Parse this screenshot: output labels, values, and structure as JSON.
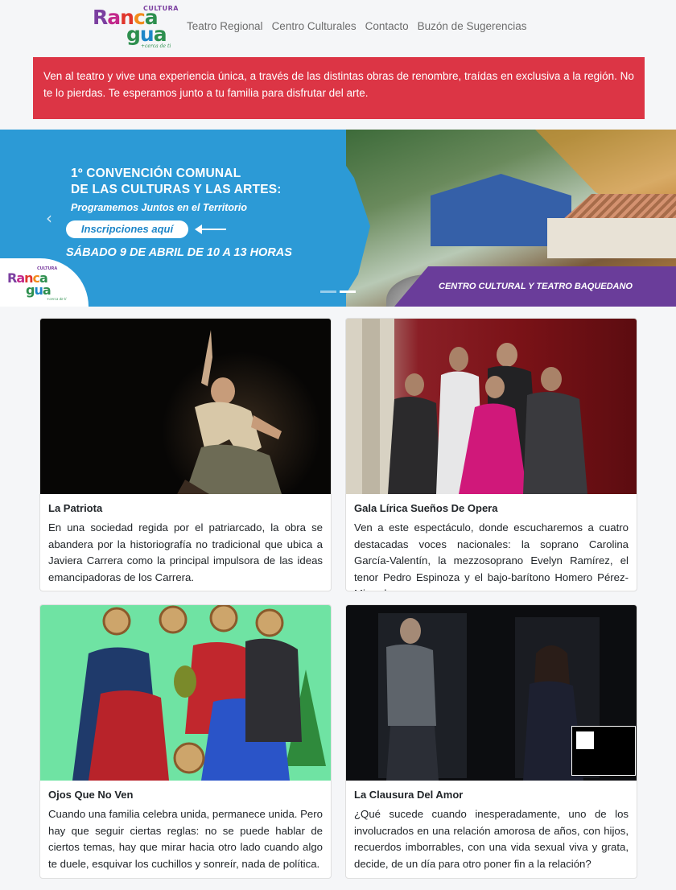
{
  "logo": {
    "top": "CULTURA",
    "word1": "Ranca",
    "word2": "gua",
    "tagline": "+cerca de ti"
  },
  "nav": {
    "links": [
      "Teatro Regional",
      "Centro Culturales",
      "Contacto",
      "Buzón de Sugerencias"
    ]
  },
  "alert": {
    "text": "Ven al teatro y vive una experiencia única, a través de las distintas obras de renombre, traídas en exclusiva a la región. No te lo pierdas. Te esperamos junto a tu familia para disfrutar del arte."
  },
  "carousel": {
    "title_line1": "1º CONVENCIÓN COMUNAL",
    "title_line2": "DE LAS CULTURAS Y LAS ARTES:",
    "subtitle": "Programemos Juntos en el Territorio",
    "cta": "Inscripciones aquí",
    "date": "SÁBADO 9 DE ABRIL DE 10 A 13 HORAS",
    "place": "CENTRO CULTURAL Y TEATRO BAQUEDANO",
    "prev_icon": "‹",
    "slides": 2,
    "active_slide": 2
  },
  "cards": [
    {
      "title": "La Patriota",
      "text": "En una sociedad regida por el patriarcado, la obra se abandera por la historiografía no tradicional que ubica a Javiera Carrera como la principal impulsora de las ideas emancipadoras de los Carrera."
    },
    {
      "title": "Gala Lírica Sueños De Opera",
      "text": "Ven a este espectáculo, donde escucharemos a cuatro destacadas voces nacionales: la soprano Carolina García-Valentín, la mezzosoprano Evelyn Ramírez, el tenor Pedro Espinoza y el bajo-barítono Homero Pérez-Miranda."
    },
    {
      "title": "Ojos Que No Ven",
      "text": "Cuando una familia celebra unida, permanece unida. Pero hay que seguir ciertas reglas: no se puede hablar de ciertos temas, hay que mirar hacia otro lado cuando algo te duele, esquivar los cuchillos y sonreír, nada de política."
    },
    {
      "title": "La Clausura Del Amor",
      "text": "¿Qué sucede cuando inesperadamente, uno de los involucrados en una relación amorosa de años, con hijos, recuerdos imborrables, con una vida sexual viva y grata, decide, de un día para otro poner fin a la relación?"
    }
  ],
  "colors": {
    "alert_bg": "#dc3545",
    "banner_blue": "#2c9ad6",
    "banner_purple": "#6a3d9a"
  }
}
